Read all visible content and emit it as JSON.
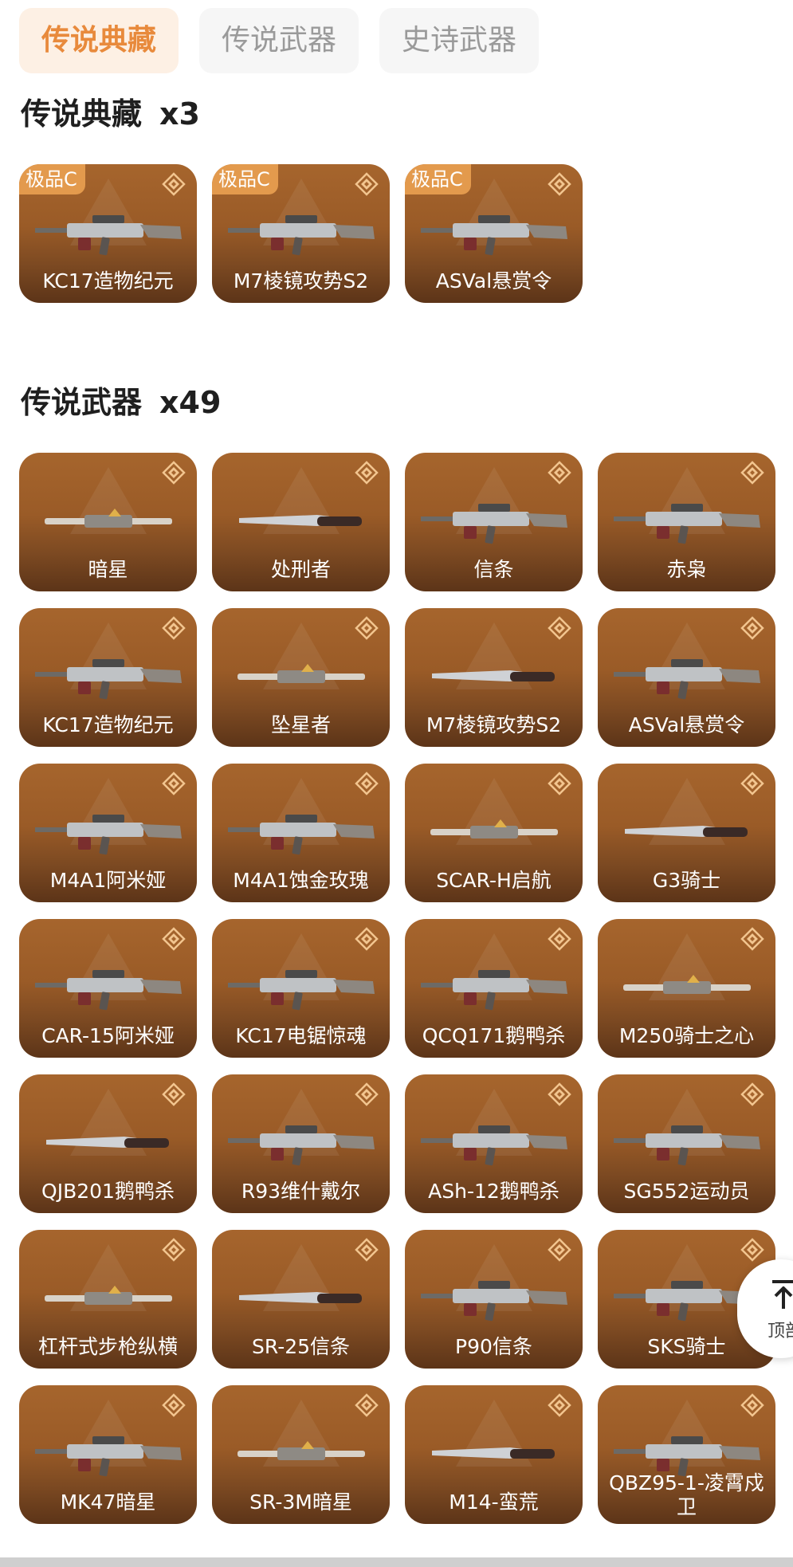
{
  "tabs": [
    {
      "label": "传说典藏"
    },
    {
      "label": "传说武器"
    },
    {
      "label": "史诗武器"
    }
  ],
  "sections": {
    "collection": {
      "title": "传说典藏",
      "count": "x3"
    },
    "legendary": {
      "title": "传说武器",
      "count": "x49"
    }
  },
  "collection_items": [
    {
      "badge": "极品C",
      "name": "KC17造物纪元"
    },
    {
      "badge": "极品C",
      "name": "M7棱镜攻势S2"
    },
    {
      "badge": "极品C",
      "name": "ASVal悬赏令"
    }
  ],
  "legendary_items": [
    {
      "name": "暗星"
    },
    {
      "name": "处刑者"
    },
    {
      "name": "信条"
    },
    {
      "name": "赤枭"
    },
    {
      "name": "KC17造物纪元"
    },
    {
      "name": "坠星者"
    },
    {
      "name": "M7棱镜攻势S2"
    },
    {
      "name": "ASVal悬赏令"
    },
    {
      "name": "M4A1阿米娅"
    },
    {
      "name": "M4A1蚀金玫瑰"
    },
    {
      "name": "SCAR-H启航"
    },
    {
      "name": "G3骑士"
    },
    {
      "name": "CAR-15阿米娅"
    },
    {
      "name": "KC17电锯惊魂"
    },
    {
      "name": "QCQ171鹅鸭杀"
    },
    {
      "name": "M250骑士之心"
    },
    {
      "name": "QJB201鹅鸭杀"
    },
    {
      "name": "R93维什戴尔"
    },
    {
      "name": "ASh-12鹅鸭杀"
    },
    {
      "name": "SG552运动员"
    },
    {
      "name": "杠杆式步枪纵横"
    },
    {
      "name": "SR-25信条"
    },
    {
      "name": "P90信条"
    },
    {
      "name": "SKS骑士"
    },
    {
      "name": "MK47暗星"
    },
    {
      "name": "SR-3M暗星"
    },
    {
      "name": "M14-蛮荒"
    },
    {
      "name": "QBZ95-1-凌霄戍卫"
    }
  ],
  "back_to_top": {
    "label": "顶部"
  },
  "colors": {
    "accent": "#e88a3c",
    "card": "#9a5b27",
    "badge": "#e39a4d"
  }
}
